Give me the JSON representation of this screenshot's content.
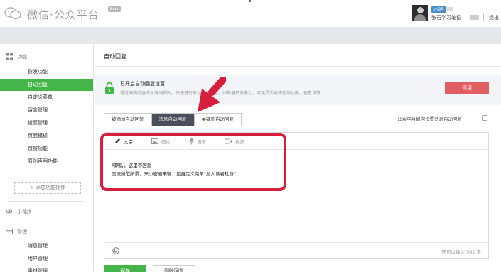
{
  "header": {
    "logo_text": "微信·公众平台",
    "beta_badge": "Beta",
    "account_tag": "订阅号",
    "account_name": "张石学习笔记",
    "logout": "退出"
  },
  "sidebar": {
    "group_function": "功能",
    "items": [
      {
        "label": "群发功能",
        "active": false
      },
      {
        "label": "自动回复",
        "active": true
      },
      {
        "label": "自定义菜单",
        "active": false
      },
      {
        "label": "留言管理",
        "active": false
      },
      {
        "label": "投票管理",
        "active": false
      },
      {
        "label": "页面模板",
        "active": false
      },
      {
        "label": "赞赏功能",
        "active": false
      },
      {
        "label": "原创声明功能",
        "active": false
      }
    ],
    "add_plugin": "+ 添加功能插件",
    "group_miniprogram": "小程序",
    "group_manage": "管理",
    "manage_items": [
      {
        "label": "消息管理"
      },
      {
        "label": "用户管理"
      },
      {
        "label": "素材管理"
      }
    ]
  },
  "main": {
    "page_title": "自动回复",
    "notice": {
      "title": "已开启自动回复设置",
      "desc": "通过编辑内容或关键词规则，快速进行自动回复设置。如具备开发能力，可更灵活地使用该功能。查看详情",
      "disable_button": "停用"
    },
    "tabs": [
      {
        "label": "被添加自动回复",
        "active": false
      },
      {
        "label": "消息自动回复",
        "active": true
      },
      {
        "label": "关键词自动回复",
        "active": false
      }
    ],
    "settings_link": "公众平台如何设置消息自动回复",
    "editor": {
      "tools": [
        {
          "label": "文字",
          "icon": "pencil-icon",
          "active": true
        },
        {
          "label": "图片",
          "icon": "image-icon",
          "active": false
        },
        {
          "label": "语音",
          "icon": "microphone-icon",
          "active": false
        },
        {
          "label": "视频",
          "icon": "video-icon",
          "active": false
        }
      ],
      "text_line1": "嘿嘿，，这里不回复",
      "text_line2": "交流所范所谓，来小密圈来聊，见自定义菜单\"加入读者社群\"",
      "counter": "还可以输入 562 字"
    },
    "save_button": "保存",
    "delete_button": "删除回复"
  },
  "colors": {
    "accent_green": "#44b549",
    "danger_red": "#e15f63",
    "annotation_red": "#d61f3c",
    "active_tab": "#4b4f5b"
  }
}
